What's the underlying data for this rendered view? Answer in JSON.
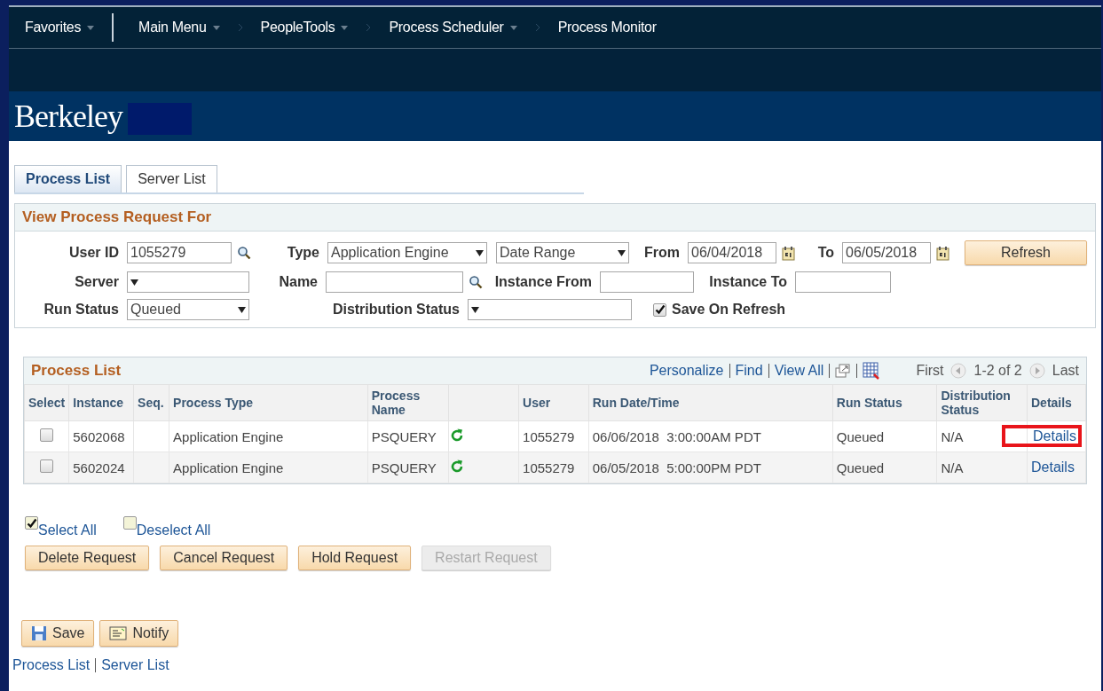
{
  "nav": [
    {
      "label": "Favorites",
      "dropdown": true,
      "chevron": false,
      "divider": true
    },
    {
      "label": "Main Menu",
      "dropdown": true,
      "chevron": true,
      "divider": false
    },
    {
      "label": "PeopleTools",
      "dropdown": true,
      "chevron": true,
      "divider": false
    },
    {
      "label": "Process Scheduler",
      "dropdown": true,
      "chevron": true,
      "divider": false
    },
    {
      "label": "Process Monitor",
      "dropdown": false,
      "chevron": false,
      "divider": false
    }
  ],
  "brand": "Berkeley",
  "tabs": [
    {
      "label": "Process List",
      "selected": true
    },
    {
      "label": "Server List",
      "selected": false
    }
  ],
  "filter": {
    "title": "View Process Request For",
    "rows": [
      [
        {
          "kind": "text",
          "label": "User ID",
          "value": "1055279",
          "lookup": true
        },
        {
          "kind": "select",
          "label": "Type",
          "value": "Application Engine"
        },
        {
          "kind": "select",
          "value": "Date Range"
        },
        {
          "kind": "date",
          "label": "From",
          "value": "06/04/2018"
        },
        {
          "kind": "date",
          "label": "To",
          "value": "06/05/2018"
        },
        {
          "kind": "button",
          "label": "Refresh"
        }
      ],
      [
        {
          "kind": "select",
          "label": "Server"
        },
        {
          "kind": "text",
          "label": "Name",
          "lookup": true
        },
        {
          "kind": "text",
          "label": "Instance From"
        },
        {
          "kind": "text",
          "label": "Instance To"
        }
      ],
      [
        {
          "kind": "select",
          "label": "Run Status",
          "value": "Queued"
        },
        {
          "kind": "select",
          "label": "Distribution Status"
        },
        "",
        {
          "kind": "checkbox",
          "label": "Save On Refresh",
          "checked": true
        }
      ]
    ]
  },
  "grid": {
    "title": "Process List",
    "links": [
      "Personalize",
      "Find",
      "View All"
    ],
    "first": "First",
    "range": "1-2 of 2",
    "last": "Last",
    "columns": [
      "Select",
      "Instance",
      "Seq.",
      "Process Type",
      "Process Name",
      "",
      "User",
      "Run Date/Time",
      "Run Status",
      "Distribution Status",
      "Details"
    ],
    "rows": [
      {
        "checked": false,
        "instance": "5602068",
        "seq": "",
        "type": "Application Engine",
        "name": "PSQUERY",
        "user": "1055279",
        "datetime": "06/06/2018  3:00:00AM PDT",
        "status": "Queued",
        "distribution": "N/A",
        "details": "Details",
        "highlighted": true
      },
      {
        "checked": false,
        "instance": "5602024",
        "seq": "",
        "type": "Application Engine",
        "name": "PSQUERY",
        "user": "1055279",
        "datetime": "06/05/2018  5:00:00PM PDT",
        "status": "Queued",
        "distribution": "N/A",
        "details": "Details",
        "highlighted": false
      }
    ]
  },
  "select_links": [
    {
      "label": "Select All",
      "checked": true
    },
    {
      "label": "Deselect All",
      "checked": false
    }
  ],
  "actions": [
    {
      "label": "Delete Request",
      "disabled": false
    },
    {
      "label": "Cancel Request",
      "disabled": false
    },
    {
      "label": "Hold Request",
      "disabled": false
    },
    {
      "label": "Restart Request",
      "disabled": true
    }
  ],
  "toolbar": [
    {
      "kind": "save",
      "label": "Save"
    },
    {
      "kind": "notify",
      "label": "Notify"
    }
  ],
  "footer_links": [
    "Process List",
    "Server List"
  ]
}
